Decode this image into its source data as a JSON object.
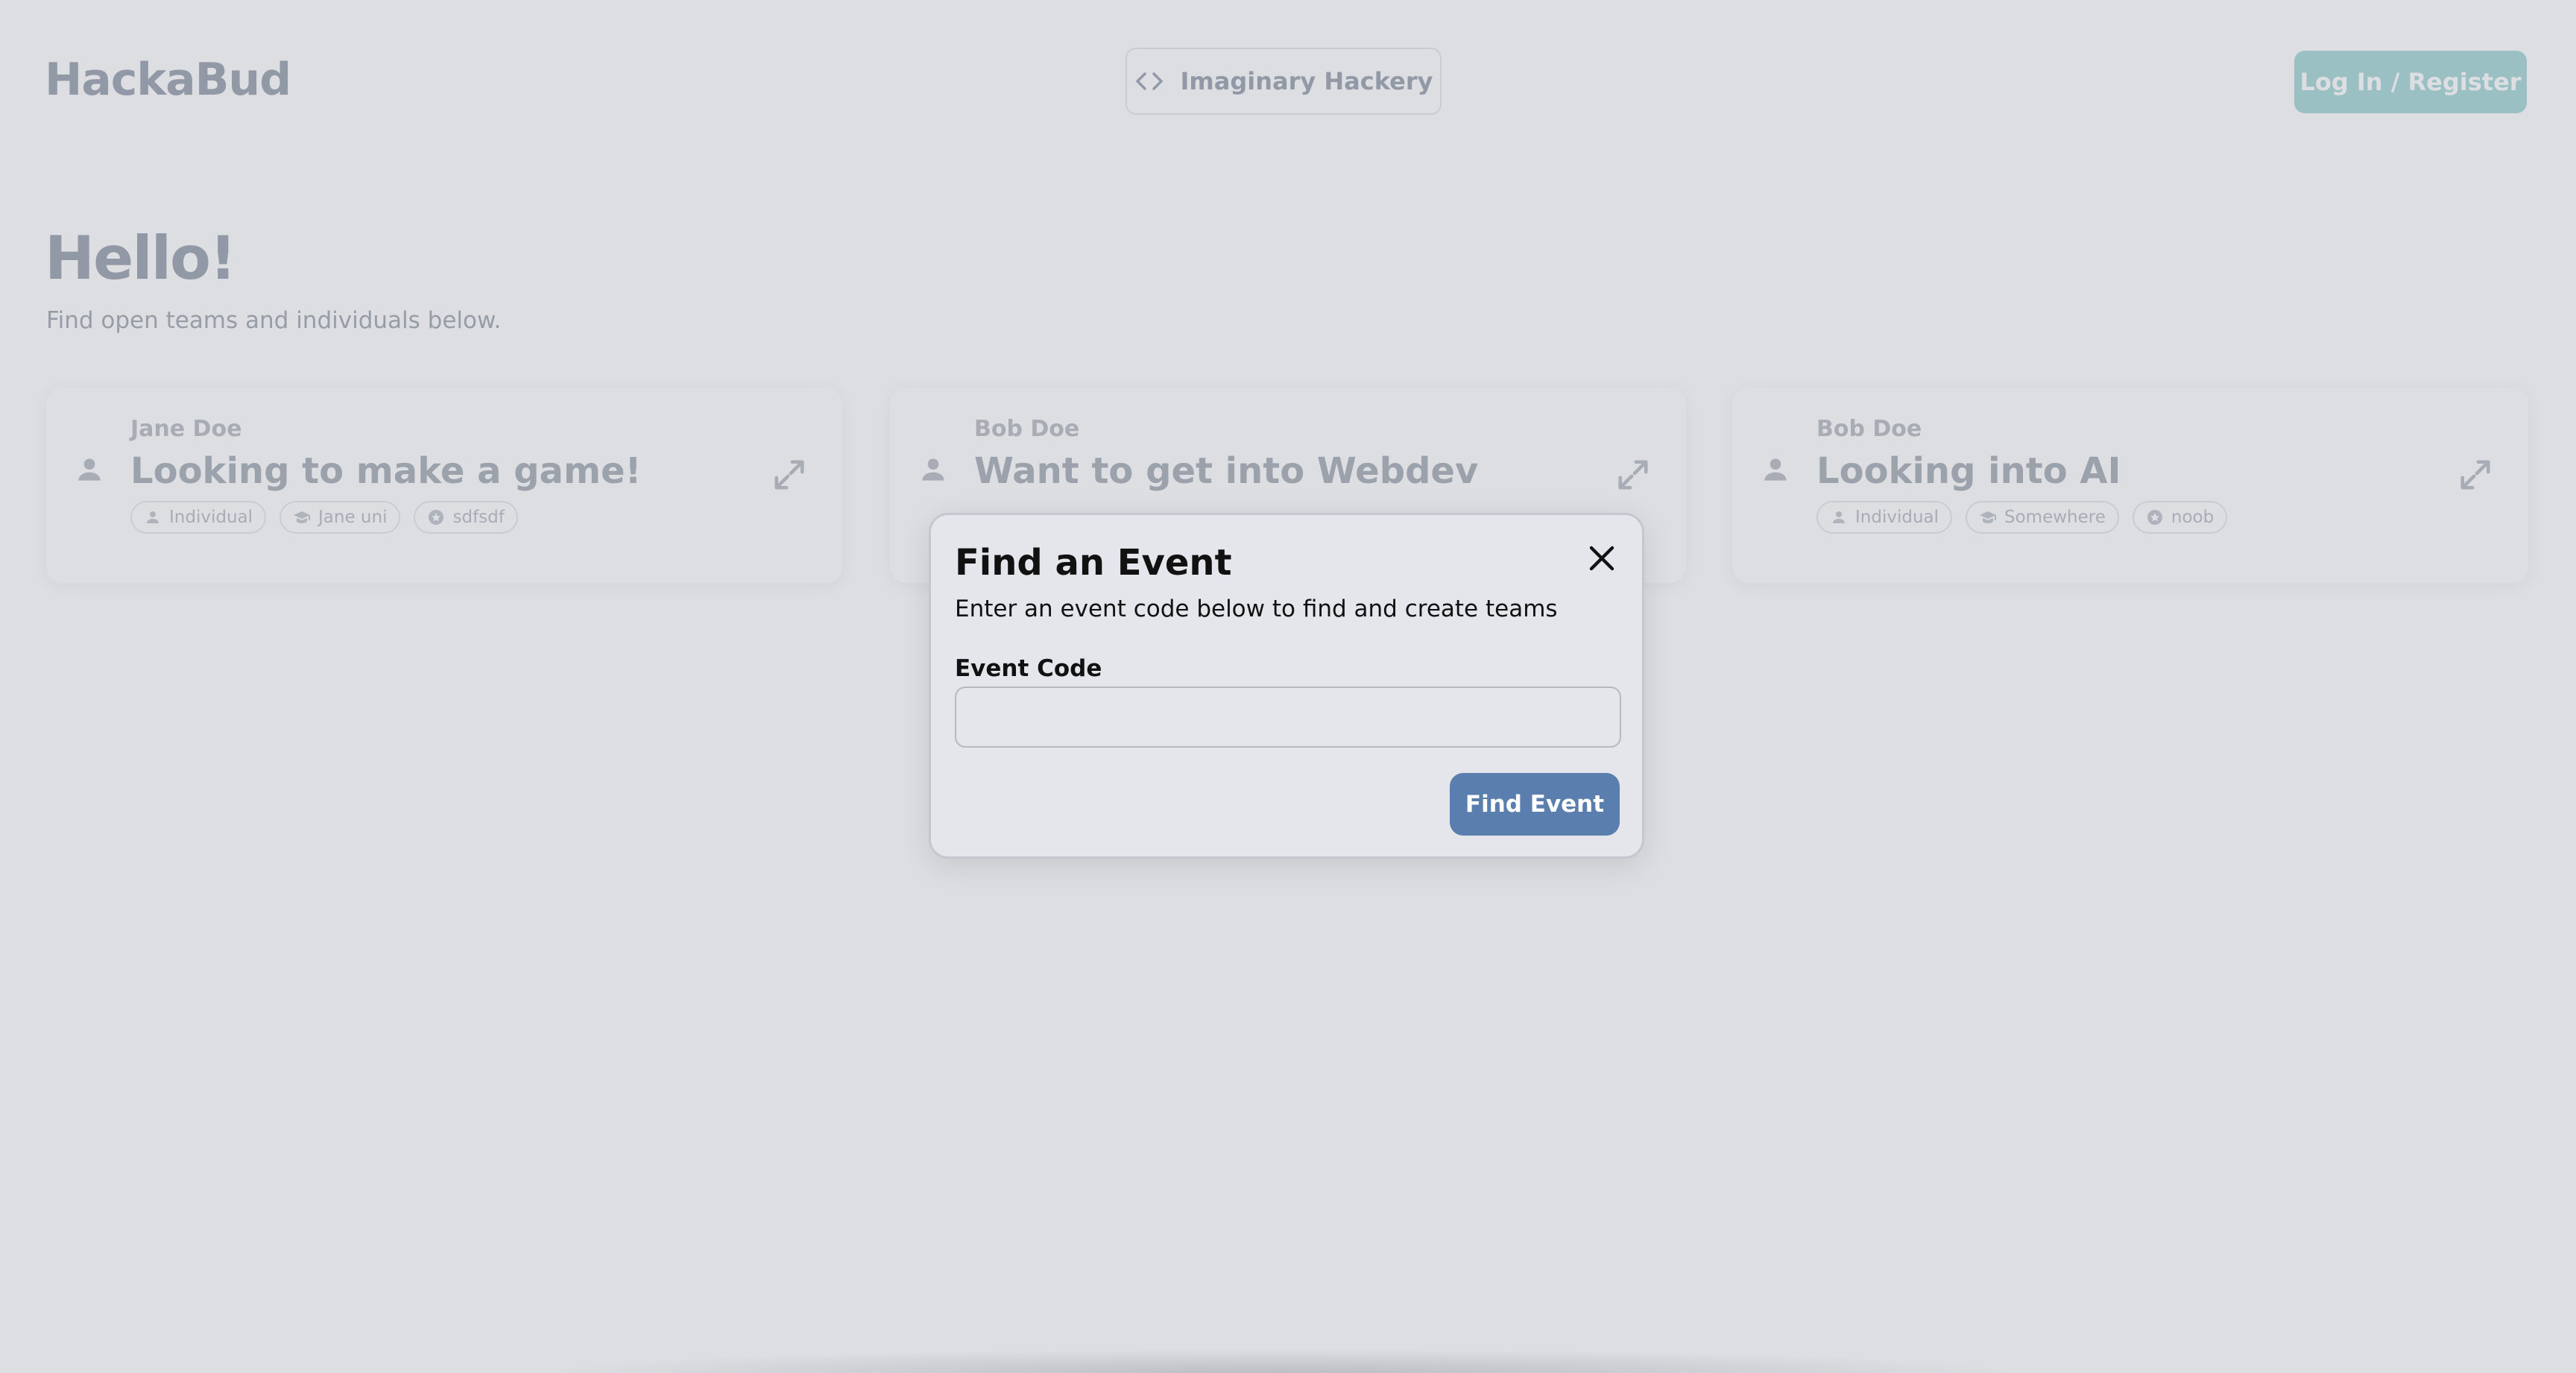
{
  "header": {
    "brand": "HackaBud",
    "event_name": "Imaginary Hackery",
    "login_label": "Log In / Register"
  },
  "greeting": {
    "title": "Hello!",
    "subtitle": "Find open teams and individuals below."
  },
  "cards": [
    {
      "author": "Jane Doe",
      "title": "Looking to make a game!",
      "tags": [
        {
          "icon": "person-icon",
          "label": "Individual"
        },
        {
          "icon": "graduation-cap-icon",
          "label": "Jane uni"
        },
        {
          "icon": "star-badge-icon",
          "label": "sdfsdf"
        }
      ]
    },
    {
      "author": "Bob Doe",
      "title": "Want to get into Webdev",
      "tags": []
    },
    {
      "author": "Bob Doe",
      "title": "Looking into AI",
      "tags": [
        {
          "icon": "person-icon",
          "label": "Individual"
        },
        {
          "icon": "graduation-cap-icon",
          "label": "Somewhere"
        },
        {
          "icon": "star-badge-icon",
          "label": "noob"
        }
      ]
    }
  ],
  "modal": {
    "title": "Find an Event",
    "subtitle": "Enter an event code below to find and create teams",
    "field_label": "Event Code",
    "field_value": "",
    "field_placeholder": "",
    "submit_label": "Find Event"
  },
  "colors": {
    "brand_accent": "#a7d7d6",
    "primary_button": "#5a7fae",
    "overlay": "#78808e"
  }
}
